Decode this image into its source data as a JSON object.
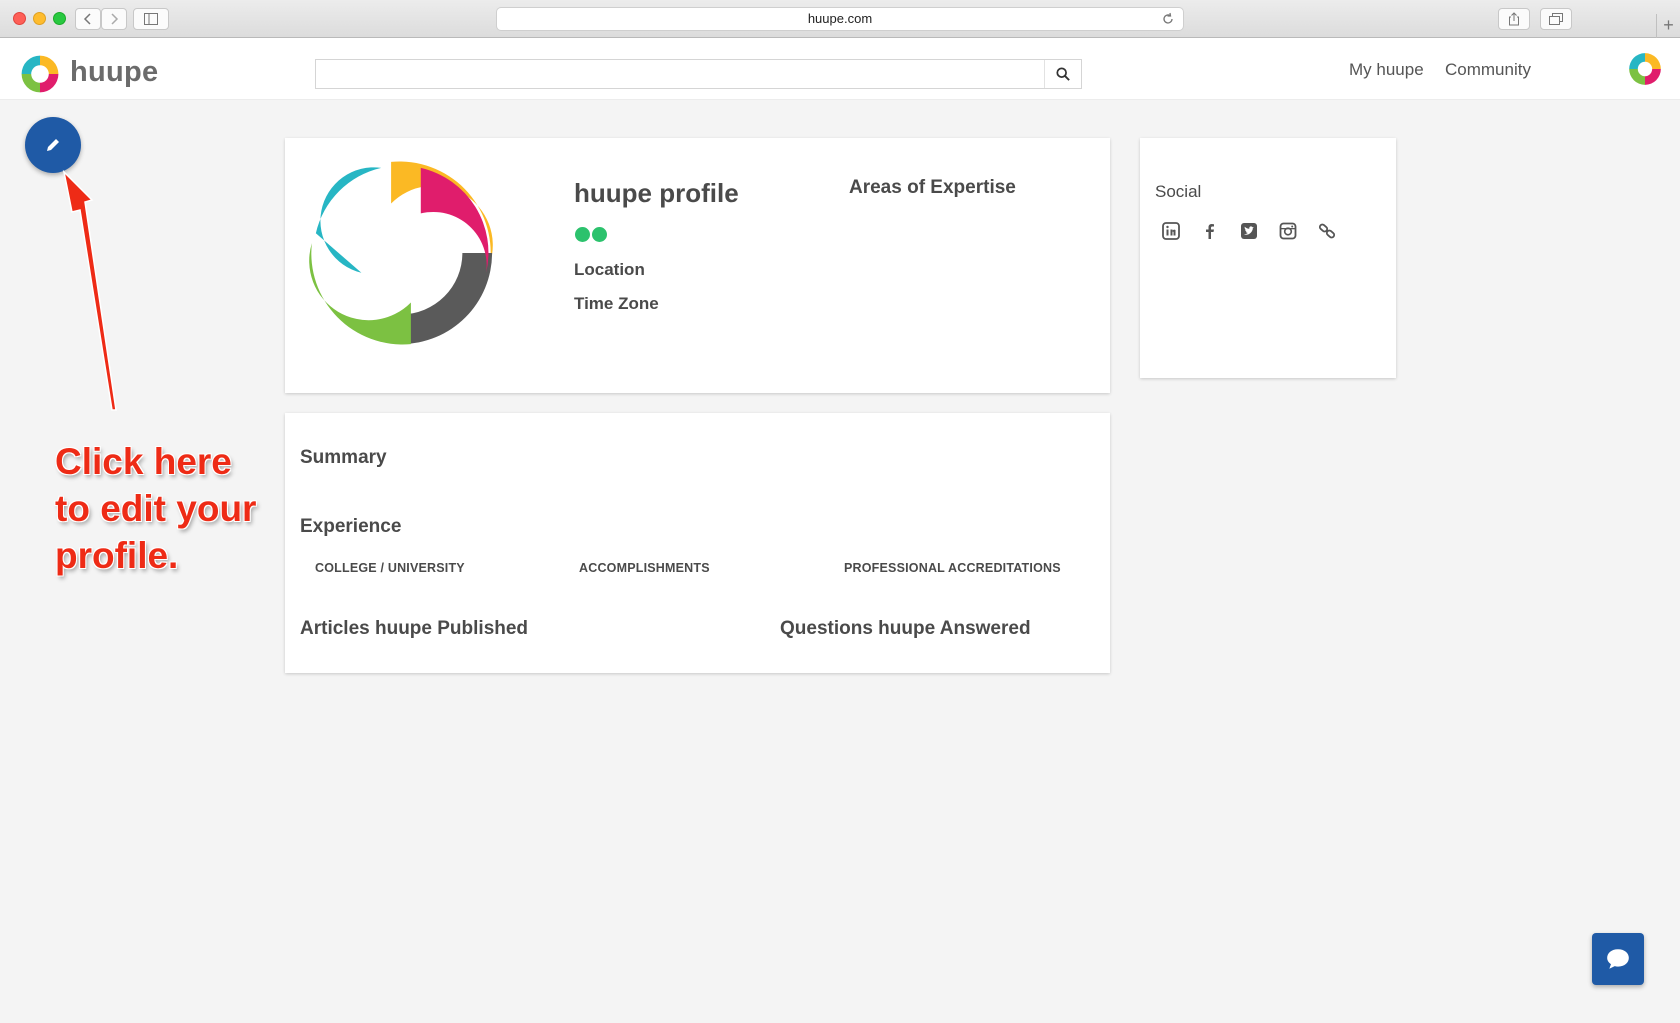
{
  "browser": {
    "url": "huupe.com"
  },
  "header": {
    "logo_text": "huupe",
    "search": {
      "value": "",
      "placeholder": ""
    },
    "nav": [
      "My huupe",
      "Community"
    ]
  },
  "annotation": {
    "lines": [
      "Click here",
      "to edit your",
      "profile."
    ]
  },
  "profile": {
    "name": "huupe profile",
    "location_label": "Location",
    "timezone_label": "Time Zone",
    "expertise_label": "Areas of Expertise"
  },
  "social": {
    "title": "Social",
    "icons": [
      "linkedin-icon",
      "facebook-icon",
      "twitter-icon",
      "instagram-icon",
      "link-icon"
    ]
  },
  "details": {
    "summary": "Summary",
    "experience": "Experience",
    "columns": [
      "COLLEGE / UNIVERSITY",
      "ACCOMPLISHMENTS",
      "PROFESSIONAL ACCREDITATIONS"
    ],
    "articles": "Articles huupe Published",
    "questions": "Questions huupe Answered"
  },
  "colors": {
    "brand_blue": "#1f5aa6",
    "status_green": "#2cc26d",
    "annotation_red": "#ee2b16",
    "logo_yellow": "#fbb924",
    "logo_pink": "#e01d6c",
    "logo_gray": "#5a5a5a",
    "logo_green": "#7cc142",
    "logo_teal": "#27b6c4"
  }
}
